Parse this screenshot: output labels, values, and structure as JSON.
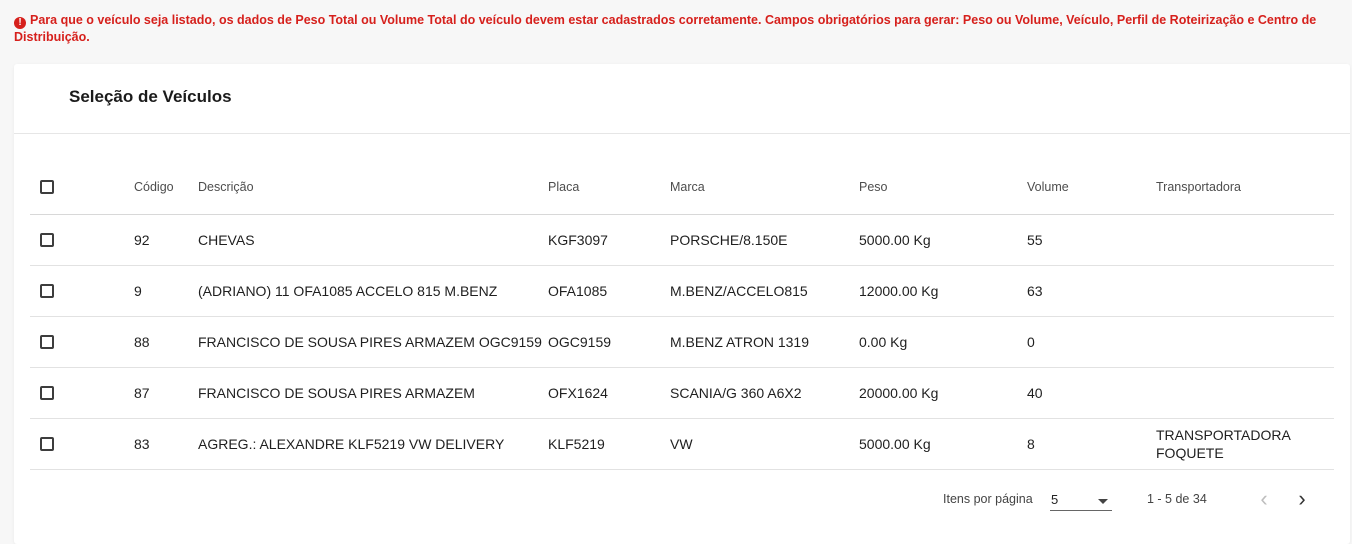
{
  "warning": {
    "icon": "exclamation-circle-icon",
    "text": "Para que o veículo seja listado, os dados de Peso Total ou Volume Total do veículo devem estar cadastrados corretamente. Campos obrigatórios para gerar: Peso ou Volume, Veículo, Perfil de Roteirização e Centro de Distribuição.",
    "color": "#d6201c"
  },
  "card": {
    "title": "Seleção de Veículos"
  },
  "table": {
    "headers": {
      "codigo": "Código",
      "descricao": "Descrição",
      "placa": "Placa",
      "marca": "Marca",
      "peso": "Peso",
      "volume": "Volume",
      "transportadora": "Transportadora"
    },
    "rows": [
      {
        "codigo": "92",
        "descricao": "CHEVAS",
        "placa": "KGF3097",
        "marca": "PORSCHE/8.150E",
        "peso": "5000.00 Kg",
        "volume": "55",
        "transportadora": ""
      },
      {
        "codigo": "9",
        "descricao": "(ADRIANO) 11 OFA1085 ACCELO 815 M.BENZ",
        "placa": "OFA1085",
        "marca": "M.BENZ/ACCELO815",
        "peso": "12000.00 Kg",
        "volume": "63",
        "transportadora": ""
      },
      {
        "codigo": "88",
        "descricao": "FRANCISCO DE SOUSA PIRES ARMAZEM OGC9159",
        "placa": "OGC9159",
        "marca": "M.BENZ ATRON 1319",
        "peso": "0.00 Kg",
        "volume": "0",
        "transportadora": ""
      },
      {
        "codigo": "87",
        "descricao": "FRANCISCO DE SOUSA PIRES ARMAZEM",
        "placa": "OFX1624",
        "marca": "SCANIA/G 360 A6X2",
        "peso": "20000.00 Kg",
        "volume": "40",
        "transportadora": ""
      },
      {
        "codigo": "83",
        "descricao": "AGREG.: ALEXANDRE KLF5219 VW DELIVERY",
        "placa": "KLF5219",
        "marca": "VW",
        "peso": "5000.00 Kg",
        "volume": "8",
        "transportadora": "TRANSPORTADORA FOQUETE"
      }
    ]
  },
  "paginator": {
    "label": "Itens por página",
    "page_size": "5",
    "range": "1 - 5 de 34",
    "prev_icon": "chevron-left-icon",
    "next_icon": "chevron-right-icon"
  }
}
